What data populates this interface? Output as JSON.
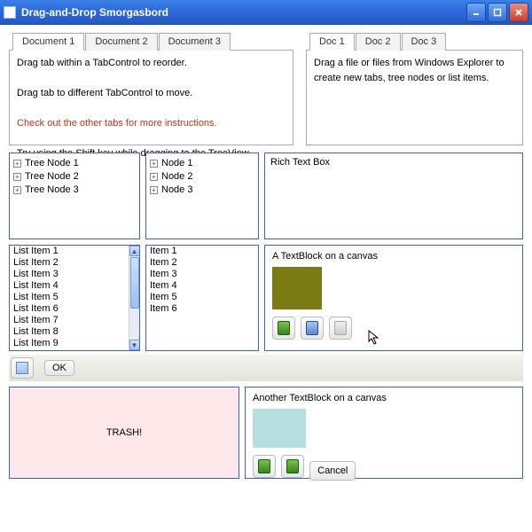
{
  "window": {
    "title": "Drag-and-Drop Smorgasbord"
  },
  "left_tabs": {
    "items": [
      "Document 1",
      "Document 2",
      "Document 3"
    ],
    "active": 0,
    "content": {
      "line1": "Drag tab within a TabControl to reorder.",
      "line2": "Drag tab to different TabControl to move.",
      "line3": "Check out the other tabs for more instructions.",
      "line4": "Try using the Shift key while dragging to the TreeView."
    }
  },
  "right_tabs": {
    "items": [
      "Doc 1",
      "Doc 2",
      "Doc 3"
    ],
    "active": 0,
    "content": {
      "line1": "Drag a file or files from Windows Explorer to create new tabs, tree nodes or list items."
    }
  },
  "tree_left": {
    "nodes": [
      "Tree Node 1",
      "Tree Node 2",
      "Tree Node 3"
    ]
  },
  "tree_right": {
    "nodes": [
      "Node 1",
      "Node 2",
      "Node 3"
    ]
  },
  "richtext": {
    "label": "Rich Text Box"
  },
  "list_left": {
    "items": [
      "List Item 1",
      "List Item 2",
      "List Item 3",
      "List Item 4",
      "List Item 5",
      "List Item 6",
      "List Item 7",
      "List Item 8",
      "List Item 9"
    ]
  },
  "list_right": {
    "items": [
      "Item 1",
      "Item 2",
      "Item 3",
      "Item 4",
      "Item 5",
      "Item 6"
    ]
  },
  "canvas_a": {
    "text": "A TextBlock on a canvas",
    "rect_color": "#7a7c12",
    "icons": [
      "green",
      "blue",
      "grey"
    ]
  },
  "toolbar": {
    "ok_label": "OK"
  },
  "trash": {
    "label": "TRASH!"
  },
  "canvas_b": {
    "text": "Another TextBlock on a canvas",
    "rect_color": "#b6dee1",
    "cancel_label": "Cancel",
    "icons": [
      "green",
      "green"
    ]
  },
  "colors": {
    "panel_border": "#3a63c5",
    "alert_text": "#c03314"
  }
}
